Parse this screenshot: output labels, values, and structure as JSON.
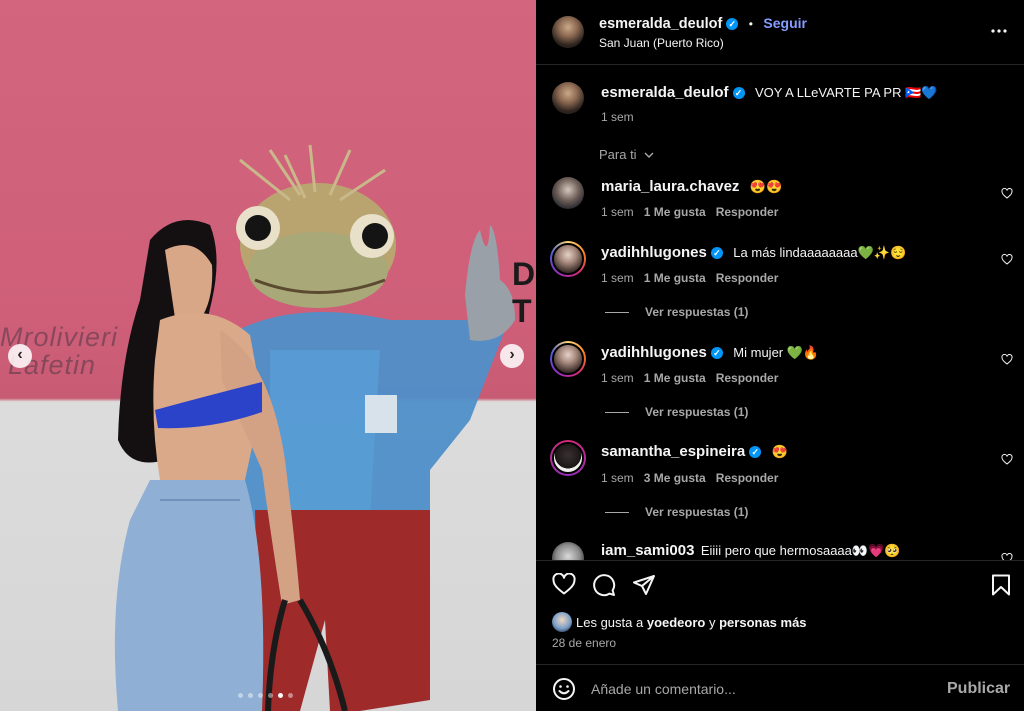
{
  "post": {
    "username": "esmeralda_deulof",
    "follow_label": "Seguir",
    "separator": "•",
    "location": "San Juan (Puerto Rico)",
    "more_icon": "more-horizontal-icon",
    "caption": "VOY A LLeVARTE PA PR 🇵🇷💙",
    "caption_time": "1 sem",
    "sort_label": "Para ti"
  },
  "photo": {
    "wall_text_1": "Mrolivieri",
    "wall_text_2": "Lafetin",
    "carousel_dots": 6,
    "active_dot": 4
  },
  "comments": [
    {
      "username": "maria_laura.chavez",
      "verified": false,
      "text": "😍😍",
      "time": "1 sem",
      "likes": "1 Me gusta",
      "reply": "Responder",
      "view_replies": ""
    },
    {
      "username": "yadihhlugones",
      "verified": true,
      "text": "La más lindaaaaaaaa💚✨😌",
      "time": "1 sem",
      "likes": "1 Me gusta",
      "reply": "Responder",
      "view_replies": "Ver respuestas (1)"
    },
    {
      "username": "yadihhlugones",
      "verified": true,
      "text": "Mi mujer 💚🔥",
      "time": "1 sem",
      "likes": "1 Me gusta",
      "reply": "Responder",
      "view_replies": "Ver respuestas (1)"
    },
    {
      "username": "samantha_espineira",
      "verified": true,
      "text": "😍",
      "time": "1 sem",
      "likes": "3 Me gusta",
      "reply": "Responder",
      "view_replies": "Ver respuestas (1)"
    },
    {
      "username": "iam_sami003",
      "verified": false,
      "text": "Eiiii pero que hermosaaaa👀💗🥺",
      "time": "",
      "likes": "",
      "reply": "",
      "view_replies": ""
    }
  ],
  "likes": {
    "prefix": "Les gusta a",
    "user": "yoedeoro",
    "connector": "y",
    "others": "personas más",
    "date": "28 de enero"
  },
  "composer": {
    "placeholder": "Añade un comentario...",
    "publish_label": "Publicar"
  },
  "colors": {
    "accent": "#0095f6",
    "follow": "#859dff",
    "muted": "#a8a8a8"
  }
}
